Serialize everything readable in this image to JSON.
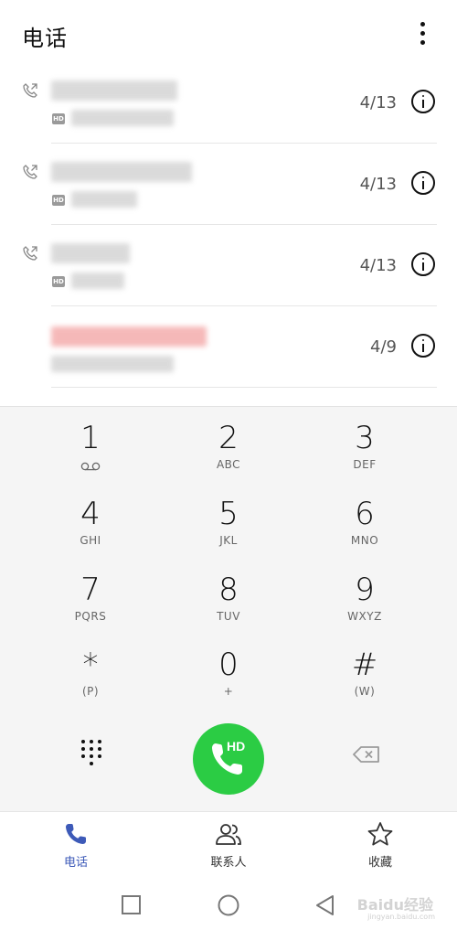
{
  "header": {
    "title": "电话"
  },
  "calls": [
    {
      "date": "4/13",
      "hd": "HD",
      "redacted": true
    },
    {
      "date": "4/13",
      "hd": "HD",
      "redacted": true
    },
    {
      "date": "4/13",
      "hd": "HD",
      "redacted": true
    },
    {
      "date": "4/9",
      "hd": "",
      "redacted": true,
      "missed": true
    }
  ],
  "dialpad": {
    "keys": [
      {
        "digit": "1",
        "letters": ""
      },
      {
        "digit": "2",
        "letters": "ABC"
      },
      {
        "digit": "3",
        "letters": "DEF"
      },
      {
        "digit": "4",
        "letters": "GHI"
      },
      {
        "digit": "5",
        "letters": "JKL"
      },
      {
        "digit": "6",
        "letters": "MNO"
      },
      {
        "digit": "7",
        "letters": "PQRS"
      },
      {
        "digit": "8",
        "letters": "TUV"
      },
      {
        "digit": "9",
        "letters": "WXYZ"
      },
      {
        "digit": "*",
        "letters": "(P)"
      },
      {
        "digit": "0",
        "letters": "+"
      },
      {
        "digit": "#",
        "letters": "(W)"
      }
    ],
    "call_button_label": "HD"
  },
  "bottom_nav": {
    "items": [
      {
        "label": "电话"
      },
      {
        "label": "联系人"
      },
      {
        "label": "收藏"
      }
    ]
  },
  "watermark": {
    "main": "Baidu经验",
    "sub": "jingyan.baidu.com"
  },
  "colors": {
    "accent": "#3d5ab8",
    "call_green": "#2bcc44",
    "missed_red": "#f08a8a"
  }
}
